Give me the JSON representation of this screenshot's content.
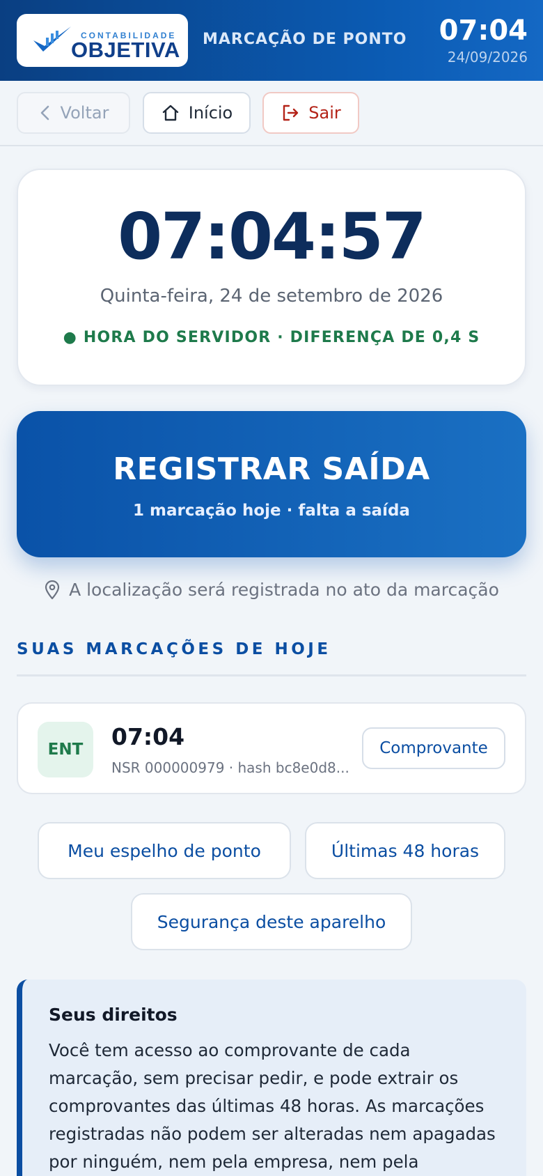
{
  "header": {
    "logo_small": "CONTABILIDADE",
    "logo_big": "OBJETIVA",
    "title": "MARCAÇÃO DE PONTO",
    "time": "07:04",
    "date": "24/09/2026"
  },
  "nav": {
    "back_label": "Voltar",
    "home_label": "Início",
    "exit_label": "Sair"
  },
  "clock": {
    "time": "07:04:57",
    "date_long": "Quinta-feira, 24 de setembro de 2026",
    "status": "● HORA DO SERVIDOR · DIFERENÇA DE 0,4 S"
  },
  "register": {
    "title": "REGISTRAR SAÍDA",
    "subtitle": "1 marcação hoje · falta a saída"
  },
  "location_note": "A localização será registrada no ato da marcação",
  "today": {
    "section_title": "SUAS MARCAÇÕES DE HOJE",
    "items": [
      {
        "badge": "ENT",
        "time": "07:04",
        "meta": "NSR 000000979 · hash bc8e0d8...",
        "receipt_label": "Comprovante"
      }
    ]
  },
  "actions": {
    "mirror_label": "Meu espelho de ponto",
    "last48_label": "Últimas 48 horas",
    "security_label": "Segurança deste aparelho"
  },
  "rights": {
    "title": "Seus direitos",
    "body": "Você tem acesso ao comprovante de cada marcação, sem precisar pedir, e pode extrair os comprovantes das últimas 48 horas. As marcações registradas não podem ser alteradas nem apagadas por ninguém, nem pela empresa, nem pela contabilidade."
  },
  "colors": {
    "brand_blue": "#0b4ea2",
    "header_blue": "#0a3f82",
    "success_green": "#1e7a4b",
    "danger_red": "#b42318"
  }
}
